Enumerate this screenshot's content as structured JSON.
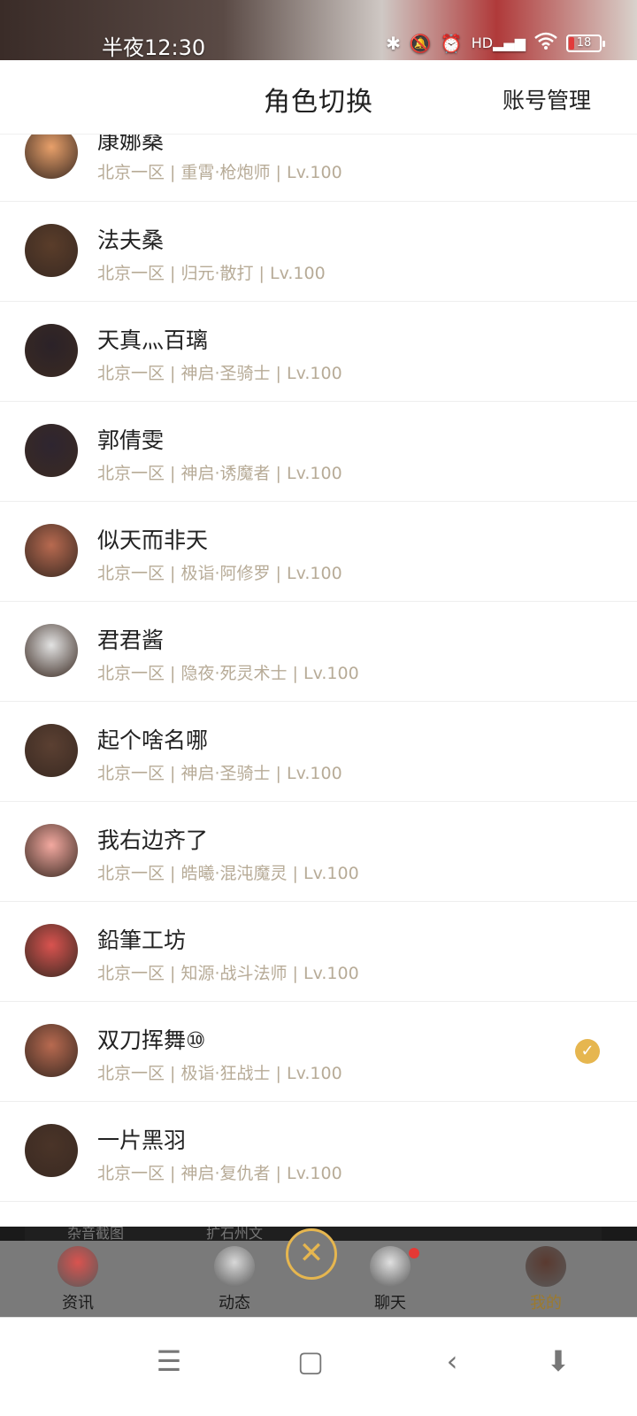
{
  "status_bar": {
    "time": "半夜12:30",
    "battery": "18",
    "icons": [
      "bluetooth-icon",
      "mute-bell-icon",
      "alarm-icon",
      "hd-signal-icon",
      "wifi-icon",
      "battery-icon"
    ]
  },
  "header": {
    "title": "角色切换",
    "account_button": "账号管理"
  },
  "characters": [
    {
      "name": "康娜桑",
      "meta": "北京一区 | 重霄·枪炮师 | Lv.100",
      "selected": false,
      "avatar_color": "#e8a06a"
    },
    {
      "name": "法夫桑",
      "meta": "北京一区 | 归元·散打 | Lv.100",
      "selected": false,
      "avatar_color": "#5a3d2a"
    },
    {
      "name": "天真灬百璃",
      "meta": "北京一区 | 神启·圣骑士 | Lv.100",
      "selected": false,
      "avatar_color": "#2b2228"
    },
    {
      "name": "郭倩雯",
      "meta": "北京一区 | 神启·诱魔者 | Lv.100",
      "selected": false,
      "avatar_color": "#2e2530"
    },
    {
      "name": "似天而非天",
      "meta": "北京一区 | 极诣·阿修罗 | Lv.100",
      "selected": false,
      "avatar_color": "#b86a50"
    },
    {
      "name": "君君酱",
      "meta": "北京一区 | 隐夜·死灵术士 | Lv.100",
      "selected": false,
      "avatar_color": "#e3e3e3"
    },
    {
      "name": "起个啥名哪",
      "meta": "北京一区 | 神启·圣骑士 | Lv.100",
      "selected": false,
      "avatar_color": "#5b4032"
    },
    {
      "name": "我右边齐了",
      "meta": "北京一区 | 皓曦·混沌魔灵 | Lv.100",
      "selected": false,
      "avatar_color": "#f3a9a0"
    },
    {
      "name": "鉛筆工坊",
      "meta": "北京一区 | 知源·战斗法师 | Lv.100",
      "selected": false,
      "avatar_color": "#d9534f"
    },
    {
      "name": "双刀挥舞⑩",
      "meta": "北京一区 | 极诣·狂战士 | Lv.100",
      "selected": true,
      "avatar_color": "#b86a50"
    },
    {
      "name": "一片黑羽",
      "meta": "北京一区 | 神启·复仇者 | Lv.100",
      "selected": false,
      "avatar_color": "#4a3428"
    }
  ],
  "peek": {
    "left": "杂音截图",
    "right": "扩石州文"
  },
  "bottom_nav": {
    "items": [
      {
        "label": "资讯",
        "icon": "news-avatar-icon",
        "color": "#d9534f"
      },
      {
        "label": "动态",
        "icon": "feed-avatar-icon",
        "color": "#d8d8d8"
      },
      {
        "label": "聊天",
        "icon": "chat-avatar-icon",
        "color": "#e0e0e0"
      },
      {
        "label": "我的",
        "icon": "profile-avatar-icon",
        "color": "#5a3a30"
      }
    ],
    "active": "我的",
    "close_icon": "close-icon"
  },
  "system_nav": {
    "menu": "☰",
    "home": "▢",
    "back": "‹",
    "assist": "⬇"
  },
  "colors": {
    "accent": "#e6b64f",
    "meta_text": "#b7ab97",
    "title_text": "#222222"
  }
}
